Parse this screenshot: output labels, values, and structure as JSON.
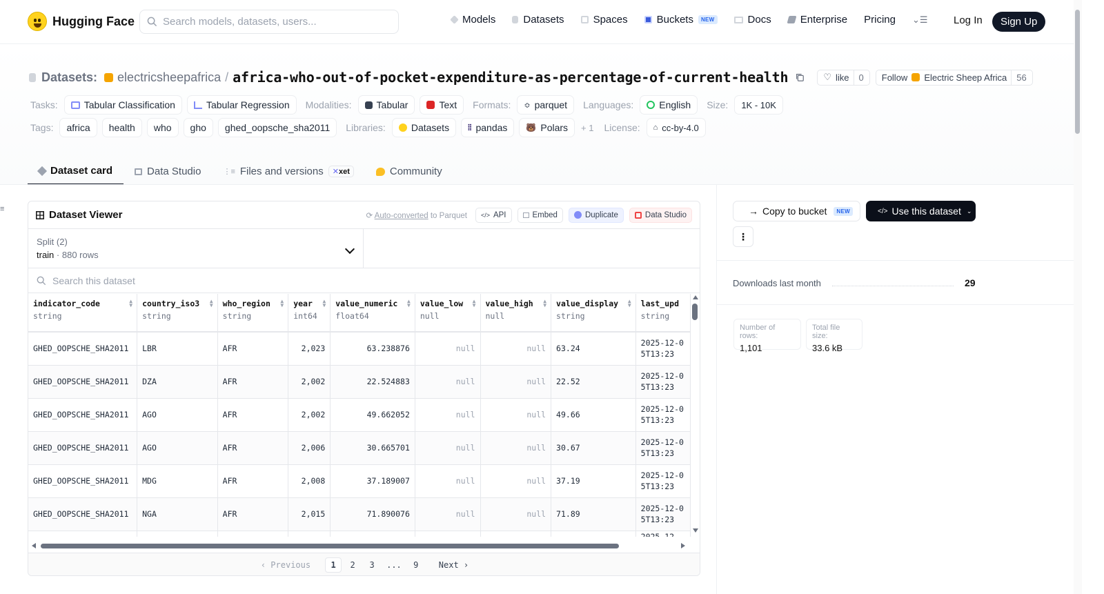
{
  "nav": {
    "logo_text": "Hugging Face",
    "search_placeholder": "Search models, datasets, users...",
    "links": [
      {
        "label": "Models"
      },
      {
        "label": "Datasets"
      },
      {
        "label": "Spaces"
      },
      {
        "label": "Buckets",
        "badge": "NEW"
      },
      {
        "label": "Docs"
      },
      {
        "label": "Enterprise"
      },
      {
        "label": "Pricing"
      }
    ],
    "login": "Log In",
    "signup": "Sign Up"
  },
  "header": {
    "section_label": "Datasets:",
    "owner": "electricsheepafrica",
    "separator": "/",
    "dataset_name": "africa-who-out-of-pocket-expenditure-as-percentage-of-current-health",
    "like_label": "like",
    "like_count": "0",
    "follow_label": "Follow",
    "follow_org": "Electric Sheep Africa",
    "follow_count": "56"
  },
  "meta": {
    "tasks_label": "Tasks:",
    "tasks": [
      "Tabular Classification",
      "Tabular Regression"
    ],
    "modalities_label": "Modalities:",
    "modalities": [
      "Tabular",
      "Text"
    ],
    "formats_label": "Formats:",
    "formats": [
      "parquet"
    ],
    "languages_label": "Languages:",
    "languages": [
      "English"
    ],
    "size_label": "Size:",
    "size": "1K - 10K",
    "tags_label": "Tags:",
    "tags": [
      "africa",
      "health",
      "who",
      "gho",
      "ghed_oopsche_sha2011"
    ],
    "libraries_label": "Libraries:",
    "libraries": [
      "Datasets",
      "pandas",
      "Polars"
    ],
    "libraries_more": "+ 1",
    "license_label": "License:",
    "license": "cc-by-4.0"
  },
  "tabs": [
    {
      "label": "Dataset card"
    },
    {
      "label": "Data Studio"
    },
    {
      "label": "Files and versions",
      "badge": "xet"
    },
    {
      "label": "Community"
    }
  ],
  "viewer": {
    "title": "Dataset Viewer",
    "auto_converted_link": "Auto-converted",
    "auto_converted_suffix": " to Parquet",
    "buttons": [
      "API",
      "Embed",
      "Duplicate",
      "Data Studio"
    ],
    "split_label": "Split (2)",
    "split_value": "train",
    "split_sep": " · ",
    "split_rows": "880 rows",
    "search_placeholder": "Search this dataset",
    "columns": [
      {
        "name": "indicator_code",
        "type": "string"
      },
      {
        "name": "country_iso3",
        "type": "string"
      },
      {
        "name": "who_region",
        "type": "string"
      },
      {
        "name": "year",
        "type": "int64"
      },
      {
        "name": "value_numeric",
        "type": "float64"
      },
      {
        "name": "value_low",
        "type": "null"
      },
      {
        "name": "value_high",
        "type": "null"
      },
      {
        "name": "value_display",
        "type": "string"
      },
      {
        "name": "last_upd",
        "type": "string"
      }
    ],
    "rows": [
      [
        "GHED_OOPSCHE_SHA2011",
        "LBR",
        "AFR",
        "2,023",
        "63.238876",
        "null",
        "null",
        "63.24",
        "2025-12-05T13:23"
      ],
      [
        "GHED_OOPSCHE_SHA2011",
        "DZA",
        "AFR",
        "2,002",
        "22.524883",
        "null",
        "null",
        "22.52",
        "2025-12-05T13:23"
      ],
      [
        "GHED_OOPSCHE_SHA2011",
        "AGO",
        "AFR",
        "2,002",
        "49.662052",
        "null",
        "null",
        "49.66",
        "2025-12-05T13:23"
      ],
      [
        "GHED_OOPSCHE_SHA2011",
        "AGO",
        "AFR",
        "2,006",
        "30.665701",
        "null",
        "null",
        "30.67",
        "2025-12-05T13:23"
      ],
      [
        "GHED_OOPSCHE_SHA2011",
        "MDG",
        "AFR",
        "2,008",
        "37.189007",
        "null",
        "null",
        "37.19",
        "2025-12-05T13:23"
      ],
      [
        "GHED_OOPSCHE_SHA2011",
        "NGA",
        "AFR",
        "2,015",
        "71.890076",
        "null",
        "null",
        "71.89",
        "2025-12-05T13:23"
      ],
      [
        "",
        "",
        "",
        "",
        "",
        "",
        "",
        "",
        "2025-12-"
      ]
    ],
    "pager": {
      "prev": "‹ Previous",
      "pages": [
        "1",
        "2",
        "3",
        "...",
        "9"
      ],
      "current": "1",
      "next": "Next ›"
    }
  },
  "sidebar": {
    "copy_to_bucket": "Copy to bucket",
    "copy_badge": "NEW",
    "use_dataset": "Use this dataset",
    "more": "⋮",
    "downloads_label": "Downloads last month",
    "downloads_value": "29",
    "num_rows_label": "Number of rows:",
    "num_rows_value": "1,101",
    "file_size_label": "Total file size:",
    "file_size_value": "33.6 kB"
  }
}
